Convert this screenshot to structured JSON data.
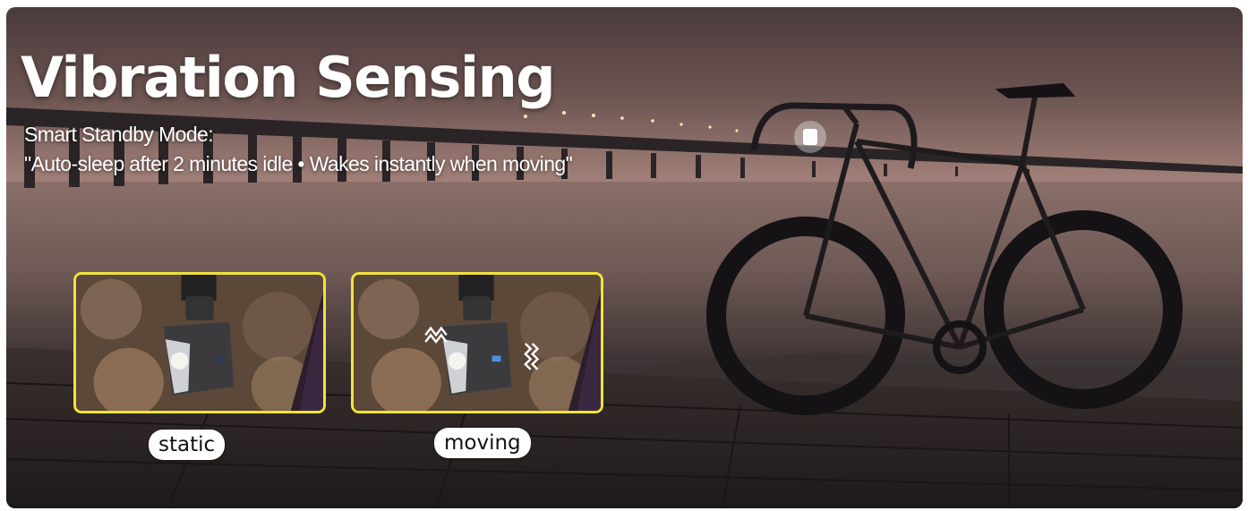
{
  "headline": {
    "title": "Vibration Sensing",
    "subtitle_line1": "Smart Standby Mode:",
    "subtitle_line2": "\"Auto-sleep after 2 minutes idle • Wakes instantly when moving\""
  },
  "states": [
    {
      "label": "static"
    },
    {
      "label": "moving"
    }
  ],
  "colors": {
    "frame_border": "#f1e33a",
    "label_bg": "#ffffff",
    "title_text": "#ffffff"
  }
}
